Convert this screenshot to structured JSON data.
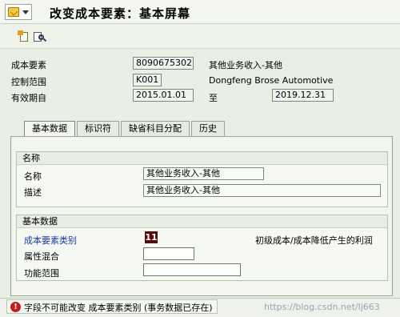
{
  "window": {
    "title": "改变成本要素：基本屏幕",
    "title_icon": "checkmark-menu-icon"
  },
  "toolbar": {
    "icons": [
      "new-document-icon",
      "display-document-icon"
    ]
  },
  "header": {
    "cost_element_label": "成本要素",
    "cost_element_value": "8090675302",
    "cost_element_desc": "其他业务收入-其他",
    "controlling_area_label": "控制范围",
    "controlling_area_value": "K001",
    "controlling_area_desc": "Dongfeng Brose Automotive",
    "valid_from_label": "有效期自",
    "valid_from_value": "2015.01.01",
    "to_label": "至",
    "valid_to_value": "2019.12.31"
  },
  "tabs": [
    {
      "label": "基本数据",
      "active": true
    },
    {
      "label": "标识符",
      "active": false
    },
    {
      "label": "缺省科目分配",
      "active": false
    },
    {
      "label": "历史",
      "active": false
    }
  ],
  "names_group": {
    "header": "名称",
    "name_label": "名称",
    "name_value": "其他业务收入-其他",
    "desc_label": "描述",
    "desc_value": "其他业务收入-其他"
  },
  "basic_group": {
    "header": "基本数据",
    "category_label": "成本要素类别",
    "category_value": "11",
    "category_desc": "初级成本/成本降低产生的利润",
    "attr_mix_label": "属性混合",
    "attr_mix_value": "",
    "func_area_label": "功能范围",
    "func_area_value": ""
  },
  "status": {
    "icon": "error-icon",
    "icon_glyph": "!",
    "message": "字段不可能改变 成本要素类别 (事务数据已存在)"
  },
  "watermark": "https://blog.csdn.net/lj663",
  "colors": {
    "background": "#e8efe4",
    "error": "#c51b1b",
    "category_highlight": "#5a0a0a",
    "link_blue": "#1a3aa8"
  }
}
